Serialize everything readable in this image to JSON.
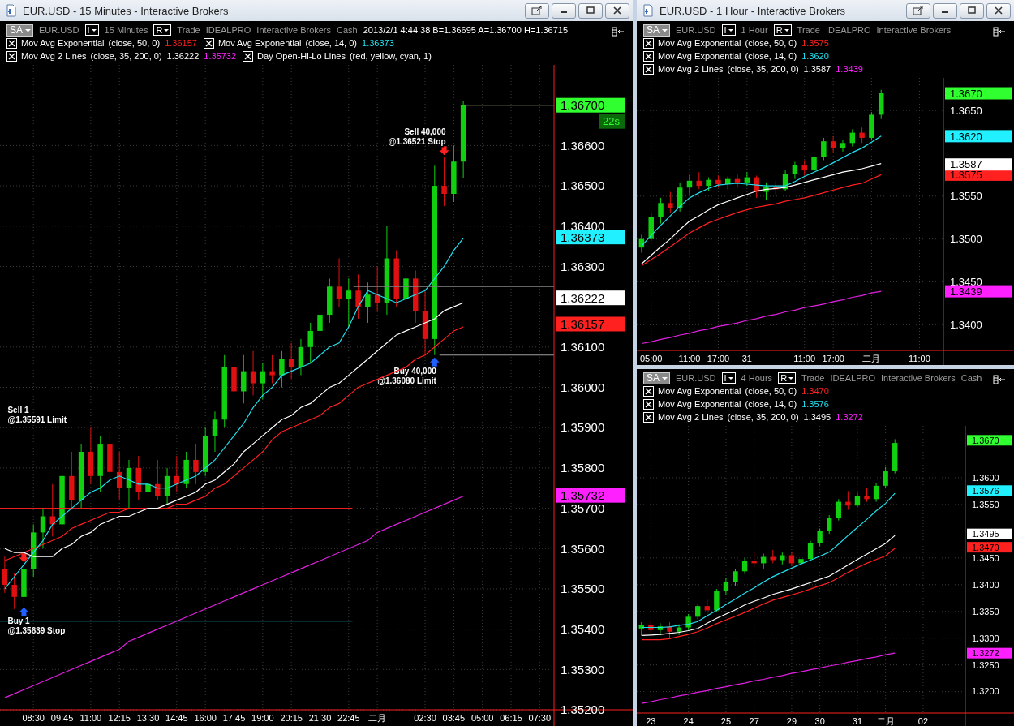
{
  "windows": [
    {
      "title": "EUR.USD - 15 Minutes - Interactive Brokers",
      "toolbar": {
        "account": "SA",
        "symbol": "EUR.USD",
        "bar_type": "I",
        "interval": "15 Minutes",
        "range": "R",
        "mode": "Trade",
        "exchange": "IDEALPRO",
        "broker": "Interactive Brokers",
        "asset": "Cash",
        "quote": "2013/2/1  4:44:38  B=1.36695  A=1.36700  H=1.36715"
      },
      "indicators": [
        {
          "checked": true,
          "name": "Mov Avg Exponential",
          "params": "(close,  50,  0)",
          "values": [
            {
              "text": "1.36157",
              "color": "#ff2020"
            }
          ]
        },
        {
          "checked": true,
          "name": "Mov Avg Exponential",
          "params": "(close,  14,  0)",
          "values": [
            {
              "text": "1.36373",
              "color": "#20e0f0"
            }
          ]
        },
        {
          "checked": true,
          "name": "Mov Avg 2 Lines",
          "params": "(close,  35,  200,  0)",
          "values": [
            {
              "text": "1.36222",
              "color": "#ffffff"
            },
            {
              "text": "1.35732",
              "color": "#ff20ff"
            }
          ]
        },
        {
          "checked": true,
          "name": "Day Open-Hi-Lo Lines",
          "params": "(red,  yellow,  cyan,  1)"
        }
      ],
      "chart_data": {
        "type": "candlestick",
        "grid": true,
        "ylim": [
          1.352,
          1.368
        ],
        "categories": [
          null,
          null,
          null,
          "08:30",
          null,
          null,
          "09:45",
          null,
          null,
          "11:00",
          null,
          null,
          "12:15",
          null,
          null,
          "13:30",
          null,
          null,
          "14:45",
          null,
          null,
          "16:00",
          null,
          null,
          "17:45",
          null,
          null,
          "19:00",
          null,
          null,
          "20:15",
          null,
          null,
          "21:30",
          null,
          null,
          "22:45",
          null,
          null,
          "二月",
          null,
          null,
          null,
          null,
          "02:30",
          null,
          null,
          "03:45",
          null,
          null,
          "05:00",
          null,
          null,
          "06:15",
          null,
          null,
          "07:30",
          null
        ],
        "ohlc": [
          [
            1.3555,
            1.3558,
            1.3549,
            1.3551
          ],
          [
            1.3551,
            1.3554,
            1.3545,
            1.3548
          ],
          [
            1.3548,
            1.3556,
            1.3546,
            1.3555
          ],
          [
            1.3555,
            1.3566,
            1.3553,
            1.3564
          ],
          [
            1.3564,
            1.357,
            1.356,
            1.3568
          ],
          [
            1.3568,
            1.3576,
            1.3563,
            1.3566
          ],
          [
            1.3566,
            1.358,
            1.3564,
            1.3578
          ],
          [
            1.3578,
            1.3584,
            1.357,
            1.3572
          ],
          [
            1.3572,
            1.3586,
            1.357,
            1.3584
          ],
          [
            1.3584,
            1.359,
            1.3576,
            1.3578
          ],
          [
            1.3578,
            1.3588,
            1.3574,
            1.3586
          ],
          [
            1.3586,
            1.3589,
            1.3576,
            1.3579
          ],
          [
            1.3579,
            1.3584,
            1.3572,
            1.3575
          ],
          [
            1.3575,
            1.3582,
            1.357,
            1.358
          ],
          [
            1.358,
            1.3583,
            1.3572,
            1.3574
          ],
          [
            1.3574,
            1.3578,
            1.357,
            1.3576
          ],
          [
            1.3576,
            1.3582,
            1.3572,
            1.3573
          ],
          [
            1.3573,
            1.358,
            1.3571,
            1.3578
          ],
          [
            1.3578,
            1.3583,
            1.3574,
            1.3576
          ],
          [
            1.3576,
            1.3584,
            1.3575,
            1.3582
          ],
          [
            1.3582,
            1.3586,
            1.3576,
            1.3579
          ],
          [
            1.3579,
            1.359,
            1.3578,
            1.3588
          ],
          [
            1.3588,
            1.3594,
            1.3584,
            1.3592
          ],
          [
            1.3592,
            1.3608,
            1.359,
            1.3605
          ],
          [
            1.3605,
            1.3611,
            1.3596,
            1.3599
          ],
          [
            1.3599,
            1.3608,
            1.3596,
            1.3604
          ],
          [
            1.3604,
            1.3609,
            1.3598,
            1.3601
          ],
          [
            1.3601,
            1.3606,
            1.3597,
            1.3604
          ],
          [
            1.3604,
            1.3608,
            1.3601,
            1.3603
          ],
          [
            1.3603,
            1.3609,
            1.36,
            1.3607
          ],
          [
            1.3607,
            1.3611,
            1.3602,
            1.3605
          ],
          [
            1.3605,
            1.3612,
            1.3603,
            1.361
          ],
          [
            1.361,
            1.3616,
            1.3606,
            1.3614
          ],
          [
            1.3614,
            1.362,
            1.361,
            1.3618
          ],
          [
            1.3618,
            1.3627,
            1.3616,
            1.3625
          ],
          [
            1.3625,
            1.3632,
            1.362,
            1.3622
          ],
          [
            1.3622,
            1.3627,
            1.3615,
            1.3624
          ],
          [
            1.3624,
            1.3628,
            1.3617,
            1.362
          ],
          [
            1.362,
            1.3626,
            1.3616,
            1.3623
          ],
          [
            1.3623,
            1.363,
            1.3619,
            1.3621
          ],
          [
            1.3621,
            1.364,
            1.3618,
            1.3632
          ],
          [
            1.3632,
            1.3634,
            1.362,
            1.3622
          ],
          [
            1.3622,
            1.363,
            1.3618,
            1.3627
          ],
          [
            1.3627,
            1.3629,
            1.3616,
            1.3619
          ],
          [
            1.3619,
            1.3624,
            1.3608,
            1.3612
          ],
          [
            1.3612,
            1.3655,
            1.3608,
            1.365
          ],
          [
            1.365,
            1.3657,
            1.3645,
            1.3648
          ],
          [
            1.3648,
            1.366,
            1.3646,
            1.3656
          ],
          [
            1.3656,
            1.3671,
            1.3652,
            1.367
          ],
          null,
          null,
          null,
          null,
          null,
          null,
          null,
          null,
          null
        ],
        "series": [
          {
            "type": "line",
            "color": "#ff2020",
            "values": [
              1.3557,
              1.3558,
              1.3559,
              1.356,
              1.3561,
              1.3562,
              1.3563,
              1.3565,
              1.3566,
              1.3567,
              1.3568,
              1.3569,
              1.3569,
              1.357,
              1.357,
              1.357,
              1.357,
              1.357,
              1.3571,
              1.3571,
              1.3572,
              1.3573,
              1.3575,
              1.3576,
              1.3578,
              1.358,
              1.3582,
              1.3584,
              1.3587,
              1.3589,
              1.359,
              1.3591,
              1.3592,
              1.3593,
              1.3595,
              1.3596,
              1.3598,
              1.36,
              1.3601,
              1.3602,
              1.3603,
              1.3604,
              1.3605,
              1.3607,
              1.3608,
              1.361,
              1.3612,
              1.3614,
              1.3615,
              null,
              null,
              null,
              null,
              null,
              null,
              null,
              null,
              null
            ]
          },
          {
            "type": "line",
            "color": "#20e0f0",
            "values": [
              1.355,
              1.3553,
              1.3556,
              1.3559,
              1.3562,
              1.3566,
              1.3568,
              1.357,
              1.3572,
              1.3574,
              1.3575,
              1.3577,
              1.3578,
              1.3577,
              1.3576,
              1.3576,
              1.3575,
              1.3575,
              1.3576,
              1.3577,
              1.3578,
              1.358,
              1.3582,
              1.3585,
              1.3588,
              1.3591,
              1.3595,
              1.3598,
              1.36,
              1.3603,
              1.3604,
              1.3605,
              1.3606,
              1.3608,
              1.361,
              1.3611,
              1.3615,
              1.362,
              1.3624,
              1.3623,
              1.3622,
              1.3621,
              1.3622,
              1.3623,
              1.3624,
              1.3627,
              1.363,
              1.3634,
              1.3637,
              null,
              null,
              null,
              null,
              null,
              null,
              null,
              null,
              null
            ]
          },
          {
            "type": "line",
            "color": "#ffffff",
            "values": [
              1.356,
              1.3559,
              1.3559,
              1.3558,
              1.3558,
              1.3558,
              1.356,
              1.3561,
              1.3563,
              1.3564,
              1.3566,
              1.3567,
              1.3568,
              1.3568,
              1.3569,
              1.357,
              1.357,
              1.3571,
              1.3572,
              1.3573,
              1.3574,
              1.3576,
              1.3577,
              1.3579,
              1.3581,
              1.3584,
              1.3586,
              1.3588,
              1.359,
              1.3592,
              1.3593,
              1.3595,
              1.3596,
              1.3598,
              1.36,
              1.3601,
              1.3603,
              1.3605,
              1.3607,
              1.3609,
              1.3611,
              1.3613,
              1.3614,
              1.3615,
              1.3616,
              1.3617,
              1.3619,
              1.362,
              1.3621,
              null,
              null,
              null,
              null,
              null,
              null,
              null,
              null,
              null
            ]
          },
          {
            "type": "line",
            "color": "#e020e0",
            "values": [
              1.3523,
              1.3524,
              1.3525,
              1.3526,
              1.3527,
              1.3528,
              1.3529,
              1.353,
              1.3531,
              1.3532,
              1.3533,
              1.3534,
              1.3535,
              1.3537,
              1.3538,
              1.3539,
              1.354,
              1.3541,
              1.3542,
              1.3543,
              1.3544,
              1.3545,
              1.3546,
              1.3547,
              1.3548,
              1.3549,
              1.355,
              1.3551,
              1.3552,
              1.3553,
              1.3554,
              1.3555,
              1.3556,
              1.3557,
              1.3558,
              1.3559,
              1.356,
              1.3561,
              1.3562,
              1.3564,
              1.3565,
              1.3566,
              1.3567,
              1.3568,
              1.3569,
              1.357,
              1.3571,
              1.3572,
              1.3573,
              null,
              null,
              null,
              null,
              null,
              null,
              null,
              null,
              null
            ]
          }
        ],
        "yticks": [
          {
            "value": 1.352,
            "label": "1.35200"
          },
          {
            "value": 1.353,
            "label": "1.35300"
          },
          {
            "value": 1.354,
            "label": "1.35400"
          },
          {
            "value": 1.355,
            "label": "1.35500"
          },
          {
            "value": 1.356,
            "label": "1.35600"
          },
          {
            "value": 1.357,
            "label": "1.35700"
          },
          {
            "value": 1.358,
            "label": "1.35800"
          },
          {
            "value": 1.359,
            "label": "1.35900"
          },
          {
            "value": 1.36,
            "label": "1.36000"
          },
          {
            "value": 1.361,
            "label": "1.36100"
          },
          {
            "value": 1.363,
            "label": "1.36300"
          },
          {
            "value": 1.364,
            "label": "1.36400"
          },
          {
            "value": 1.365,
            "label": "1.36500"
          },
          {
            "value": 1.366,
            "label": "1.36600"
          }
        ],
        "ref_lines": [
          {
            "axis": "y",
            "value": 1.357,
            "color": "#ff2020"
          },
          {
            "axis": "y",
            "value": 1.3542,
            "color": "#20e0f0"
          },
          {
            "axis": "y",
            "value": 1.3625,
            "color": "#808080"
          },
          {
            "axis": "y",
            "value": 1.3608,
            "color": "#a0a0a0"
          },
          {
            "axis": "y",
            "value": 1.367,
            "color": "#d8f0a0"
          }
        ]
      },
      "orders": [
        {
          "kind": "sell",
          "label": "Sell 1",
          "price_label": "@1.35591 Limit"
        },
        {
          "kind": "buy",
          "label": "Buy 1",
          "price_label": "@1.35639 Stop"
        },
        {
          "kind": "sell",
          "label": "Sell 40,000",
          "price_label": "@1.36521 Stop"
        },
        {
          "kind": "buy",
          "label": "Buy 40,000",
          "price_label": "@1.36080 Limit"
        }
      ],
      "price_tags": [
        {
          "label": "1.36700",
          "color": "#30ff30",
          "timer": "22s"
        },
        {
          "label": "1.36373",
          "color": "#20f0ff"
        },
        {
          "label": "1.36222",
          "color": "#ffffff"
        },
        {
          "label": "1.36157",
          "color": "#ff2020"
        },
        {
          "label": "1.35732",
          "color": "#ff20ff"
        }
      ]
    },
    {
      "title": "EUR.USD - 1 Hour - Interactive Brokers",
      "toolbar": {
        "account": "SA",
        "symbol": "EUR.USD",
        "bar_type": "I",
        "interval": "1 Hour",
        "range": "R",
        "mode": "Trade",
        "exchange": "IDEALPRO",
        "broker": "Interactive Brokers"
      },
      "indicators": [
        {
          "checked": true,
          "name": "Mov Avg Exponential",
          "params": "(close,  50,  0)",
          "values": [
            {
              "text": "1.3575",
              "color": "#ff2020"
            }
          ]
        },
        {
          "checked": true,
          "name": "Mov Avg Exponential",
          "params": "(close,  14,  0)",
          "values": [
            {
              "text": "1.3620",
              "color": "#20e0f0"
            }
          ]
        },
        {
          "checked": true,
          "name": "Mov Avg 2 Lines",
          "params": "(close,  35,  200,  0)",
          "values": [
            {
              "text": "1.3587",
              "color": "#ffffff"
            },
            {
              "text": "1.3439",
              "color": "#ff20ff"
            }
          ]
        }
      ],
      "chart_data": {
        "type": "candlestick",
        "grid": true,
        "ylim": [
          1.337,
          1.3688
        ],
        "categories": [
          null,
          "05:00",
          null,
          null,
          null,
          "11:00",
          null,
          null,
          "17:00",
          null,
          null,
          "31",
          null,
          null,
          null,
          null,
          null,
          "11:00",
          null,
          null,
          "17:00",
          null,
          null,
          null,
          "二月",
          null,
          null,
          null,
          null,
          "11:00",
          null,
          null
        ],
        "ohlc": [
          [
            1.349,
            1.3505,
            1.3484,
            1.35
          ],
          [
            1.35,
            1.353,
            1.3498,
            1.3526
          ],
          [
            1.3526,
            1.3548,
            1.3518,
            1.3542
          ],
          [
            1.3542,
            1.3555,
            1.353,
            1.3536
          ],
          [
            1.3536,
            1.3566,
            1.3532,
            1.356
          ],
          [
            1.356,
            1.3575,
            1.3552,
            1.3568
          ],
          [
            1.3568,
            1.3578,
            1.3558,
            1.3562
          ],
          [
            1.3562,
            1.3572,
            1.3556,
            1.3569
          ],
          [
            1.3569,
            1.3574,
            1.356,
            1.3564
          ],
          [
            1.3564,
            1.3573,
            1.3558,
            1.357
          ],
          [
            1.357,
            1.3575,
            1.356,
            1.3566
          ],
          [
            1.3566,
            1.3578,
            1.3562,
            1.3572
          ],
          [
            1.3572,
            1.3574,
            1.3548,
            1.3555
          ],
          [
            1.3555,
            1.3566,
            1.3545,
            1.3561
          ],
          [
            1.3561,
            1.3568,
            1.3552,
            1.3558
          ],
          [
            1.3558,
            1.358,
            1.3556,
            1.3576
          ],
          [
            1.3576,
            1.359,
            1.357,
            1.3586
          ],
          [
            1.3586,
            1.3592,
            1.3574,
            1.358
          ],
          [
            1.358,
            1.36,
            1.3578,
            1.3596
          ],
          [
            1.3596,
            1.3618,
            1.3592,
            1.3614
          ],
          [
            1.3614,
            1.362,
            1.36,
            1.3606
          ],
          [
            1.3606,
            1.3616,
            1.3602,
            1.3612
          ],
          [
            1.3612,
            1.3628,
            1.3608,
            1.3624
          ],
          [
            1.3624,
            1.363,
            1.3612,
            1.3618
          ],
          [
            1.3618,
            1.3648,
            1.3615,
            1.3645
          ],
          [
            1.3645,
            1.3674,
            1.364,
            1.367
          ],
          null,
          null,
          null,
          null,
          null,
          null
        ],
        "series": [
          {
            "type": "line",
            "color": "#ff2020",
            "values": [
              1.3469,
              1.3476,
              1.3483,
              1.3491,
              1.3499,
              1.3507,
              1.3513,
              1.3519,
              1.3523,
              1.3527,
              1.3531,
              1.3534,
              1.3537,
              1.3539,
              1.3541,
              1.3544,
              1.3546,
              1.3548,
              1.3551,
              1.3554,
              1.3557,
              1.356,
              1.3563,
              1.3565,
              1.357,
              1.3575,
              null,
              null,
              null,
              null,
              null,
              null
            ]
          },
          {
            "type": "line",
            "color": "#20e0f0",
            "values": [
              1.3492,
              1.3504,
              1.3516,
              1.3527,
              1.3538,
              1.3548,
              1.3554,
              1.3559,
              1.3563,
              1.3564,
              1.3565,
              1.3564,
              1.3563,
              1.3562,
              1.3562,
              1.3562,
              1.3567,
              1.3573,
              1.3578,
              1.3583,
              1.3589,
              1.3595,
              1.3601,
              1.3606,
              1.3613,
              1.362,
              null,
              null,
              null,
              null,
              null,
              null
            ]
          },
          {
            "type": "line",
            "color": "#ffffff",
            "values": [
              1.3471,
              1.3481,
              1.3491,
              1.35,
              1.3511,
              1.3521,
              1.3527,
              1.3534,
              1.354,
              1.3544,
              1.3548,
              1.3552,
              1.3556,
              1.3558,
              1.3559,
              1.356,
              1.3563,
              1.3566,
              1.3569,
              1.3572,
              1.3575,
              1.3578,
              1.358,
              1.3582,
              1.3585,
              1.3588,
              null,
              null,
              null,
              null,
              null,
              null
            ]
          },
          {
            "type": "line",
            "color": "#e020e0",
            "values": [
              1.3378,
              1.338,
              1.3383,
              1.3385,
              1.3388,
              1.339,
              1.3393,
              1.3395,
              1.3398,
              1.34,
              1.3402,
              1.3405,
              1.3407,
              1.341,
              1.3412,
              1.3415,
              1.3417,
              1.342,
              1.3422,
              1.3424,
              1.3427,
              1.3429,
              1.3432,
              1.3434,
              1.3437,
              1.3439,
              null,
              null,
              null,
              null,
              null,
              null
            ]
          }
        ],
        "yticks": [
          {
            "value": 1.34,
            "label": "1.3400"
          },
          {
            "value": 1.345,
            "label": "1.3450"
          },
          {
            "value": 1.35,
            "label": "1.3500"
          },
          {
            "value": 1.355,
            "label": "1.3550"
          },
          {
            "value": 1.365,
            "label": "1.3650"
          }
        ]
      },
      "price_tags": [
        {
          "label": "1.3670",
          "color": "#30ff30"
        },
        {
          "label": "1.3620",
          "color": "#20f0ff"
        },
        {
          "label": "1.3587",
          "color": "#ffffff"
        },
        {
          "label": "1.3575",
          "color": "#ff2020"
        },
        {
          "label": "1.3439",
          "color": "#ff20ff"
        }
      ]
    },
    {
      "toolbar": {
        "account": "SA",
        "symbol": "EUR.USD",
        "bar_type": "I",
        "interval": "4 Hours",
        "range": "R",
        "mode": "Trade",
        "exchange": "IDEALPRO",
        "broker": "Interactive Brokers",
        "asset": "Cash"
      },
      "indicators": [
        {
          "checked": true,
          "name": "Mov Avg Exponential",
          "params": "(close,  50,  0)",
          "values": [
            {
              "text": "1.3470",
              "color": "#ff2020"
            }
          ]
        },
        {
          "checked": true,
          "name": "Mov Avg Exponential",
          "params": "(close,  14,  0)",
          "values": [
            {
              "text": "1.3576",
              "color": "#20e0f0"
            }
          ]
        },
        {
          "checked": true,
          "name": "Mov Avg 2 Lines",
          "params": "(close,  35,  200,  0)",
          "values": [
            {
              "text": "1.3495",
              "color": "#ffffff"
            },
            {
              "text": "1.3272",
              "color": "#ff20ff"
            }
          ]
        }
      ],
      "chart_data": {
        "type": "candlestick",
        "grid": true,
        "ylim": [
          1.316,
          1.3697
        ],
        "categories": [
          null,
          "23",
          null,
          null,
          null,
          "24",
          null,
          null,
          null,
          "25",
          null,
          null,
          "27",
          null,
          null,
          null,
          "29",
          null,
          null,
          "30",
          null,
          null,
          null,
          "31",
          null,
          null,
          "二月",
          null,
          null,
          null,
          "02",
          null,
          null,
          null,
          null
        ],
        "ohlc": [
          [
            1.3318,
            1.333,
            1.3305,
            1.3325
          ],
          [
            1.3325,
            1.3332,
            1.331,
            1.3315
          ],
          [
            1.3315,
            1.3328,
            1.3305,
            1.3322
          ],
          [
            1.3322,
            1.333,
            1.33,
            1.3312
          ],
          [
            1.3312,
            1.3326,
            1.3306,
            1.332
          ],
          [
            1.332,
            1.3345,
            1.3315,
            1.334
          ],
          [
            1.334,
            1.3365,
            1.3335,
            1.336
          ],
          [
            1.336,
            1.3372,
            1.3345,
            1.3352
          ],
          [
            1.3352,
            1.3392,
            1.3348,
            1.3388
          ],
          [
            1.3388,
            1.3412,
            1.338,
            1.3405
          ],
          [
            1.3405,
            1.343,
            1.3398,
            1.3425
          ],
          [
            1.3425,
            1.345,
            1.342,
            1.3445
          ],
          [
            1.3445,
            1.3462,
            1.3432,
            1.344
          ],
          [
            1.344,
            1.3458,
            1.343,
            1.3452
          ],
          [
            1.3452,
            1.3465,
            1.344,
            1.3446
          ],
          [
            1.3446,
            1.346,
            1.3438,
            1.3455
          ],
          [
            1.3455,
            1.3462,
            1.3435,
            1.344
          ],
          [
            1.344,
            1.3452,
            1.3432,
            1.3448
          ],
          [
            1.3448,
            1.3482,
            1.3444,
            1.3478
          ],
          [
            1.3478,
            1.3505,
            1.3472,
            1.35
          ],
          [
            1.35,
            1.353,
            1.3495,
            1.3525
          ],
          [
            1.3525,
            1.356,
            1.352,
            1.3555
          ],
          [
            1.3555,
            1.3575,
            1.354,
            1.3548
          ],
          [
            1.3548,
            1.3572,
            1.3545,
            1.3566
          ],
          [
            1.3566,
            1.358,
            1.3555,
            1.356
          ],
          [
            1.356,
            1.359,
            1.3555,
            1.3585
          ],
          [
            1.3585,
            1.362,
            1.358,
            1.3612
          ],
          [
            1.3612,
            1.3672,
            1.3608,
            1.3665
          ],
          null,
          null,
          null,
          null,
          null,
          null,
          null
        ],
        "series": [
          {
            "type": "line",
            "color": "#ff2020",
            "values": [
              1.3297,
              1.3297,
              1.3297,
              1.3299,
              1.3303,
              1.3307,
              1.3312,
              1.3319,
              1.3327,
              1.3334,
              1.3341,
              1.3348,
              1.3356,
              1.3364,
              1.3371,
              1.3376,
              1.3381,
              1.3386,
              1.3392,
              1.3398,
              1.3404,
              1.3413,
              1.3423,
              1.3432,
              1.344,
              1.3447,
              1.3454,
              1.3468,
              null,
              null,
              null,
              null,
              null,
              null,
              null
            ]
          },
          {
            "type": "line",
            "color": "#20e0f0",
            "values": [
              1.332,
              1.332,
              1.332,
              1.3321,
              1.3324,
              1.3326,
              1.3331,
              1.3342,
              1.3352,
              1.3363,
              1.3373,
              1.3384,
              1.3394,
              1.3405,
              1.3415,
              1.3423,
              1.3431,
              1.3439,
              1.3446,
              1.3453,
              1.3461,
              1.3476,
              1.3492,
              1.3507,
              1.3522,
              1.3538,
              1.3552,
              1.3571,
              null,
              null,
              null,
              null,
              null,
              null,
              null
            ]
          },
          {
            "type": "line",
            "color": "#ffffff",
            "values": [
              1.3305,
              1.3306,
              1.3307,
              1.3309,
              1.3311,
              1.3314,
              1.3318,
              1.3328,
              1.3337,
              1.3345,
              1.3353,
              1.3362,
              1.3369,
              1.3375,
              1.3382,
              1.3387,
              1.3392,
              1.3398,
              1.3404,
              1.341,
              1.3416,
              1.3426,
              1.3437,
              1.3447,
              1.3457,
              1.3467,
              1.3477,
              1.3492,
              null,
              null,
              null,
              null,
              null,
              null,
              null
            ]
          },
          {
            "type": "line",
            "color": "#e020e0",
            "values": [
              1.3178,
              1.3181,
              1.3185,
              1.3188,
              1.3192,
              1.3195,
              1.3199,
              1.3202,
              1.3206,
              1.3209,
              1.3213,
              1.3216,
              1.322,
              1.3223,
              1.3227,
              1.323,
              1.3234,
              1.3237,
              1.3241,
              1.3244,
              1.3248,
              1.3251,
              1.3255,
              1.3258,
              1.3262,
              1.3265,
              1.3269,
              1.3272,
              null,
              null,
              null,
              null,
              null,
              null,
              null
            ]
          }
        ],
        "yticks": [
          {
            "value": 1.32,
            "label": "1.3200"
          },
          {
            "value": 1.325,
            "label": "1.3250"
          },
          {
            "value": 1.33,
            "label": "1.3300"
          },
          {
            "value": 1.335,
            "label": "1.3350"
          },
          {
            "value": 1.34,
            "label": "1.3400"
          },
          {
            "value": 1.345,
            "label": "1.3450"
          },
          {
            "value": 1.355,
            "label": "1.3550"
          },
          {
            "value": 1.36,
            "label": "1.3600"
          }
        ]
      },
      "price_tags": [
        {
          "label": "1.3670",
          "color": "#30ff30"
        },
        {
          "label": "1.3576",
          "color": "#20f0ff"
        },
        {
          "label": "1.3495",
          "color": "#ffffff"
        },
        {
          "label": "1.3470",
          "color": "#ff2020"
        },
        {
          "label": "1.3272",
          "color": "#ff20ff"
        }
      ]
    }
  ]
}
